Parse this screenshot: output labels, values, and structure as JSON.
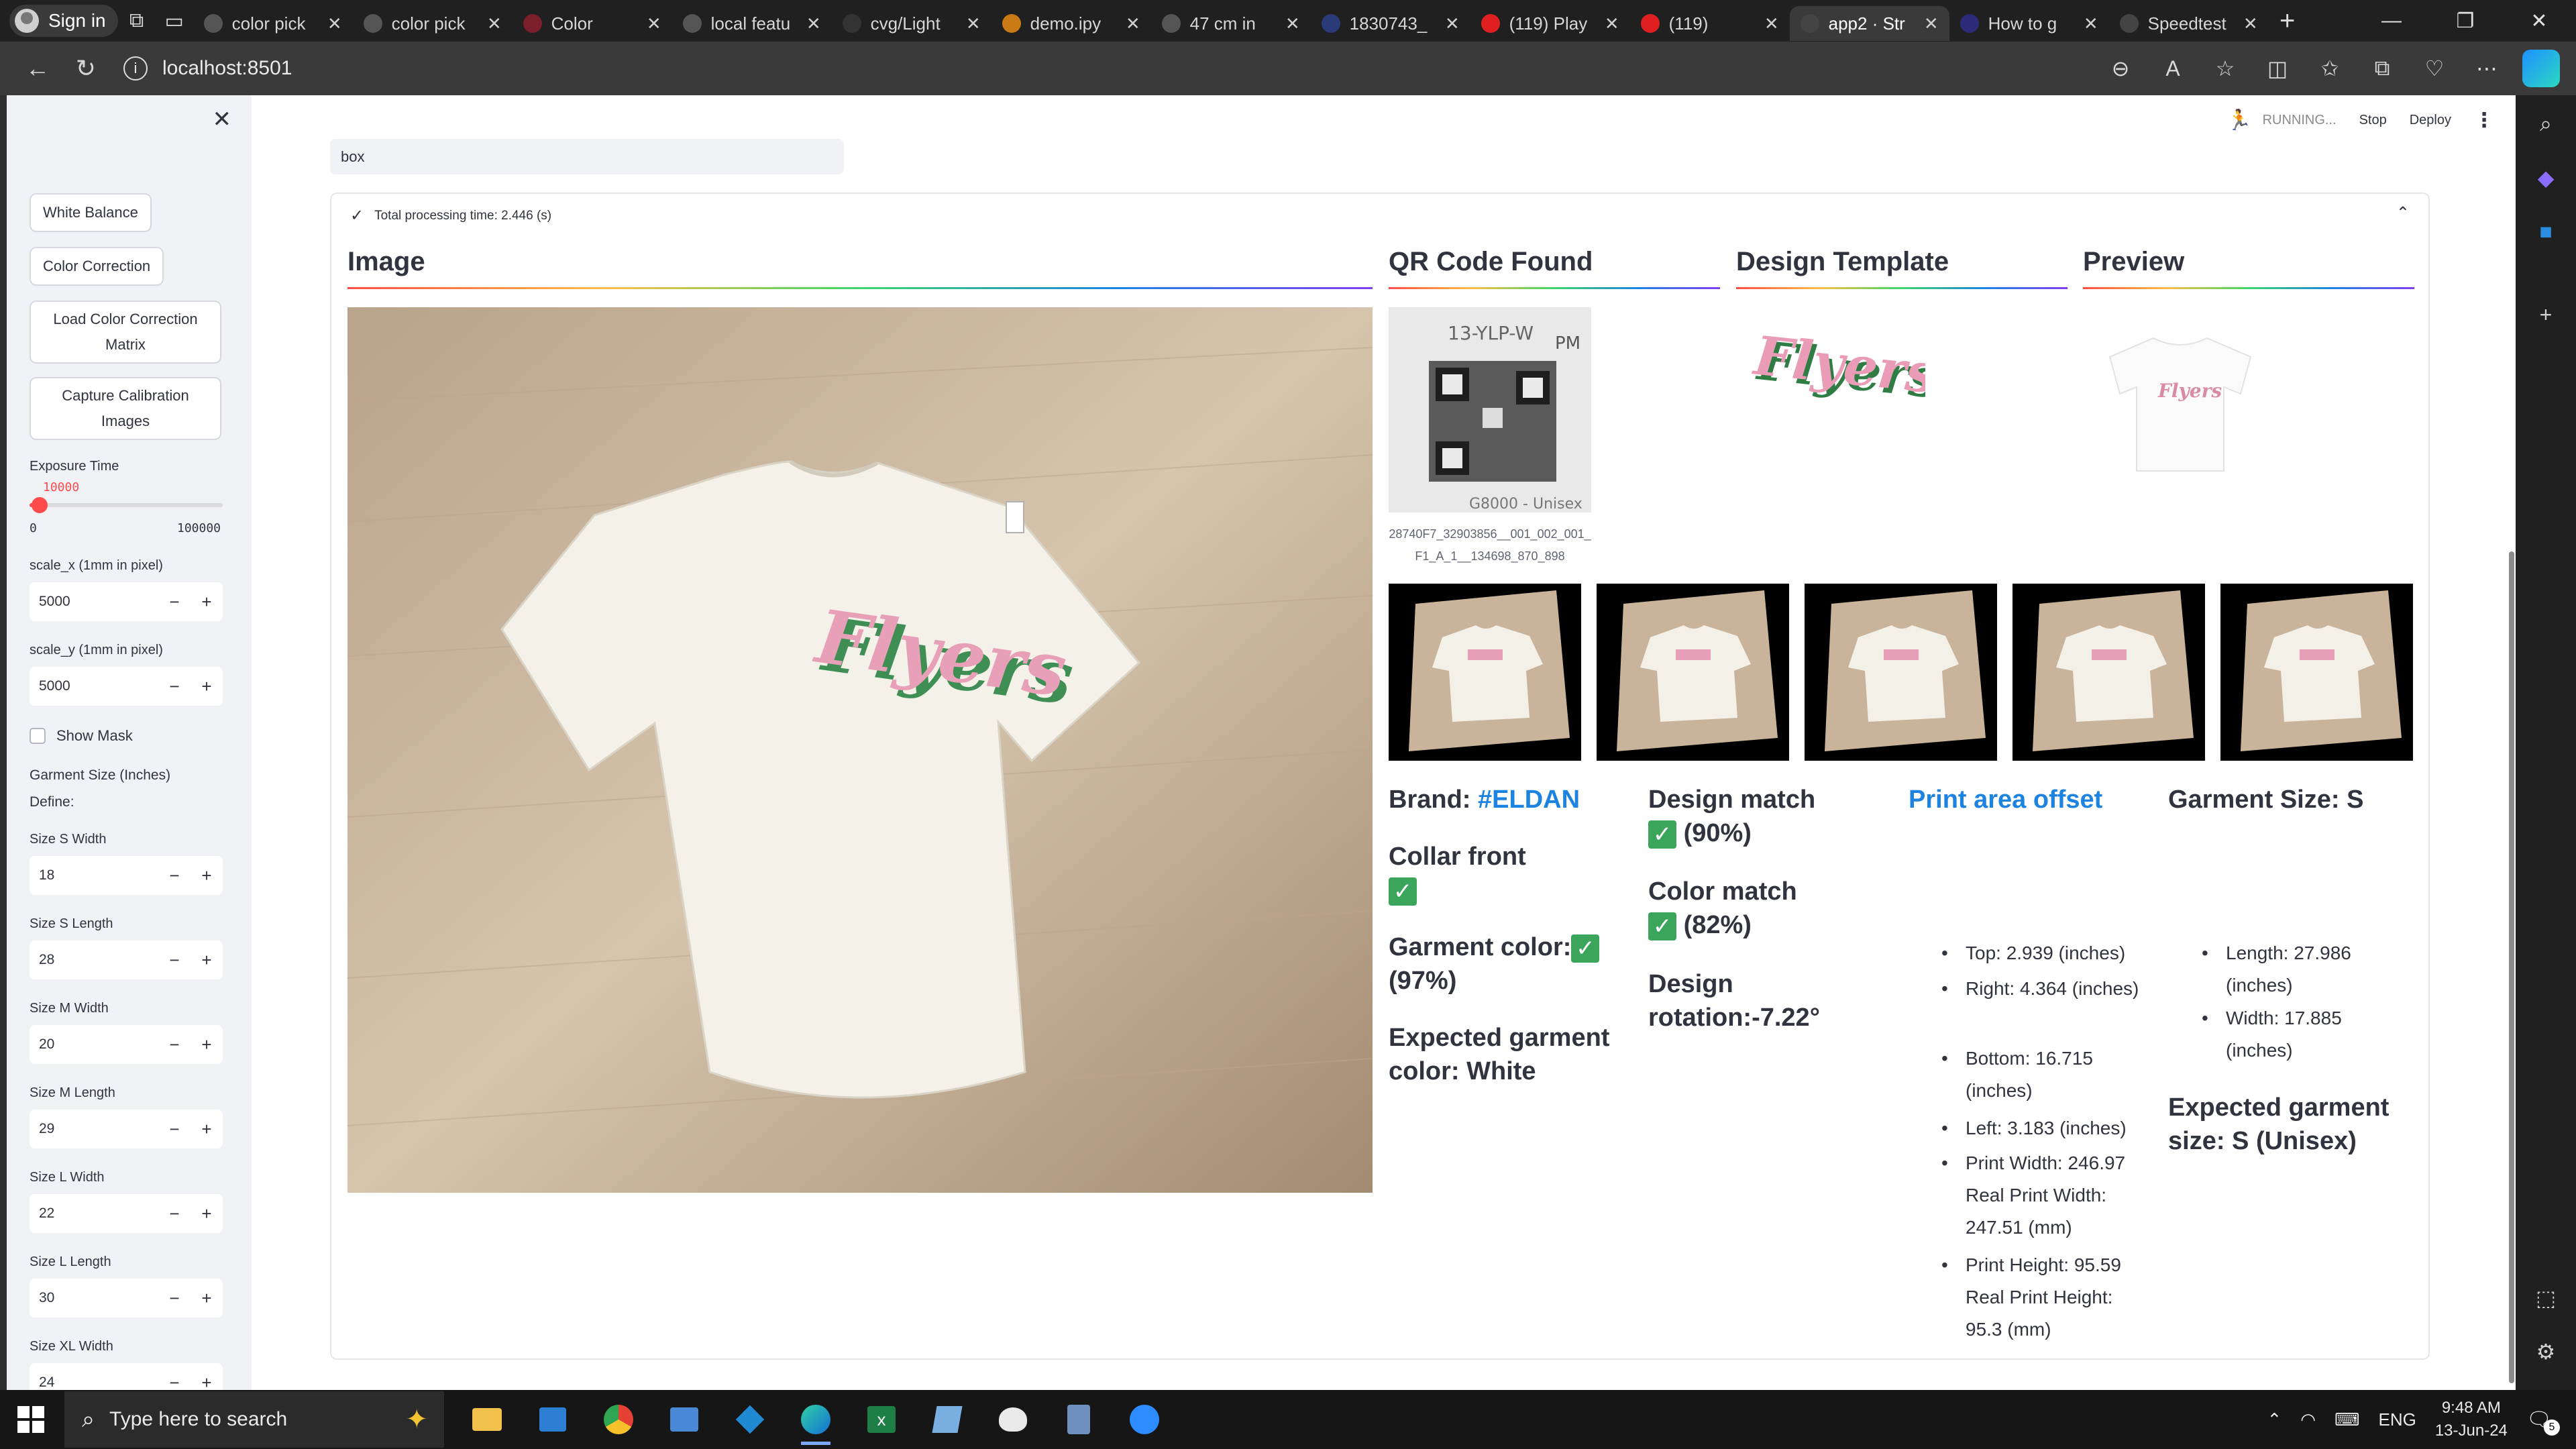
{
  "browser": {
    "sign_in": "Sign in",
    "tabs": [
      {
        "title": "color pick",
        "active": false
      },
      {
        "title": "color pick",
        "active": false
      },
      {
        "title": "Color",
        "active": false
      },
      {
        "title": "local featu",
        "active": false
      },
      {
        "title": "cvg/Light",
        "active": false
      },
      {
        "title": "demo.ipy",
        "active": false
      },
      {
        "title": "47 cm in",
        "active": false
      },
      {
        "title": "1830743_",
        "active": false
      },
      {
        "title": "(119) Play",
        "active": false
      },
      {
        "title": "(119)",
        "active": false
      },
      {
        "title": "app2 · Str",
        "active": true
      },
      {
        "title": "How to g",
        "active": false
      },
      {
        "title": "Speedtest",
        "active": false
      }
    ],
    "url": "localhost:8501"
  },
  "sidebar": {
    "buttons": [
      "White Balance",
      "Color Correction",
      "Load Color Correction Matrix",
      "Capture Calibration Images"
    ],
    "exposure": {
      "label": "Exposure Time",
      "value": "10000",
      "min": "0",
      "max": "100000",
      "fraction": 0.1
    },
    "scale_x": {
      "label": "scale_x (1mm in pixel)",
      "value": "5000"
    },
    "scale_y": {
      "label": "scale_y (1mm in pixel)",
      "value": "5000"
    },
    "show_mask": "Show Mask",
    "garment_size_label": "Garment Size (Inches)",
    "define_label": "Define:",
    "sizes": [
      {
        "label": "Size S Width",
        "value": "18"
      },
      {
        "label": "Size S Length",
        "value": "28"
      },
      {
        "label": "Size M Width",
        "value": "20"
      },
      {
        "label": "Size M Length",
        "value": "29"
      },
      {
        "label": "Size L Width",
        "value": "22"
      },
      {
        "label": "Size L Length",
        "value": "30"
      },
      {
        "label": "Size XL Width",
        "value": "24"
      }
    ]
  },
  "header": {
    "status": "RUNNING...",
    "stop": "Stop",
    "deploy": "Deploy"
  },
  "main": {
    "search_value": "box",
    "processing": "Total processing time: 2.446 (s)",
    "cols": {
      "image": "Image",
      "qr": "QR Code Found",
      "template": "Design Template",
      "preview": "Preview"
    },
    "qr_caption": "28740F7_32903856__001_002_001_F1_A_1__134698_870_898",
    "brand_label": "Brand:",
    "brand_value": "#ELDAN",
    "collar_front": "Collar front",
    "garment_color": "Garment color:",
    "garment_color_pct": "(97%)",
    "expected_color": "Expected garment color: White",
    "design_match": "Design match",
    "design_match_pct": "(90%)",
    "color_match": "Color match",
    "color_match_pct": "(82%)",
    "design_rotation": "Design rotation:-7.22°",
    "print_offset_title": "Print area offset",
    "offsets": [
      "Top: 2.939 (inches)",
      "Right: 4.364 (inches)",
      "Bottom: 16.715 (inches)",
      "Left: 3.183 (inches)",
      "Print Width: 246.97 Real Print Width: 247.51 (mm)",
      "Print Height: 95.59 Real Print Height: 95.3 (mm)"
    ],
    "garment_size_title": "Garment Size: S",
    "garment_sizes": [
      "Length: 27.986 (inches)",
      "Width: 17.885 (inches)"
    ],
    "expected_size": "Expected garment size: S (Unisex)",
    "design_text": "Flyers"
  },
  "taskbar": {
    "search_placeholder": "Type here to search",
    "lang": "ENG",
    "time": "9:48 AM",
    "date": "13-Jun-24",
    "badge": "5"
  }
}
